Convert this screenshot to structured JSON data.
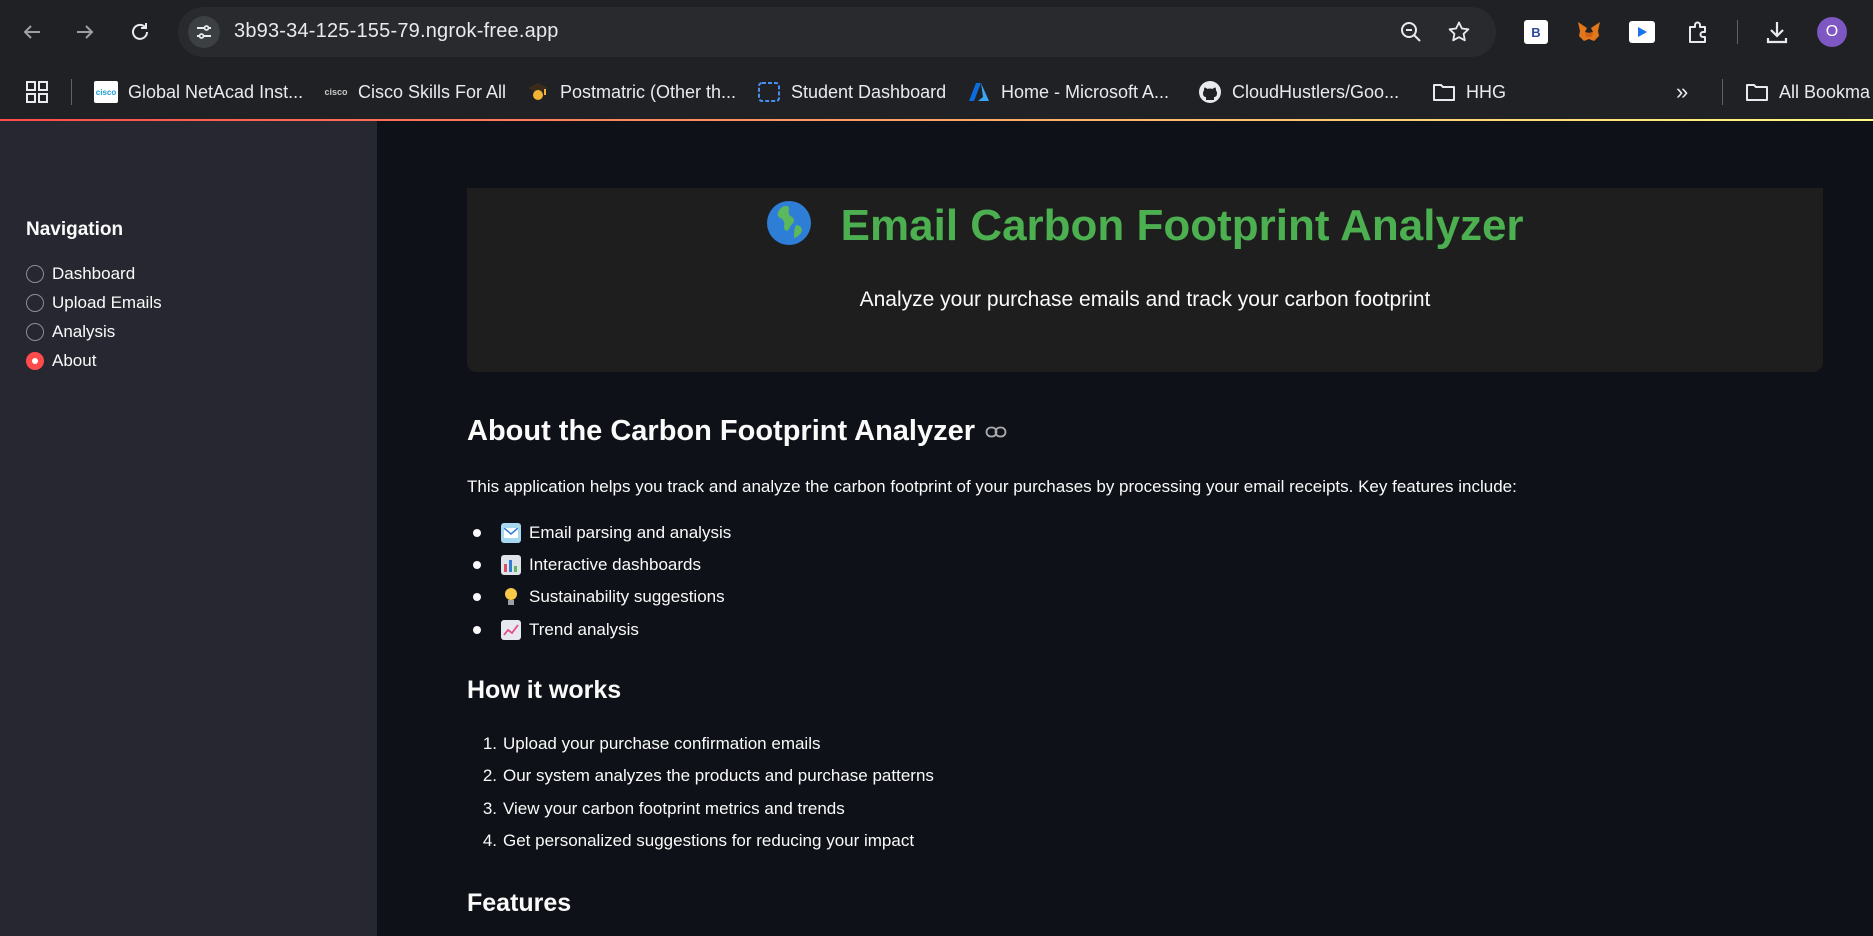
{
  "browser": {
    "url": "3b93-34-125-155-79.ngrok-free.app",
    "profile_initial": "O",
    "bookmarks": [
      {
        "label": "Global NetAcad Inst...",
        "icon": "cisco-icon"
      },
      {
        "label": "Cisco Skills For All",
        "icon": "cisco-icon"
      },
      {
        "label": "Postmatric (Other th...",
        "icon": "graduate-icon"
      },
      {
        "label": "Student Dashboard",
        "icon": "dashboard-icon"
      },
      {
        "label": "Home - Microsoft A...",
        "icon": "azure-icon"
      },
      {
        "label": "CloudHustlers/Goo...",
        "icon": "github-icon"
      },
      {
        "label": "HHG",
        "icon": "folder-icon"
      }
    ],
    "all_bookmarks": "All Bookma"
  },
  "sidebar": {
    "title": "Navigation",
    "items": [
      {
        "label": "Dashboard",
        "selected": false
      },
      {
        "label": "Upload Emails",
        "selected": false
      },
      {
        "label": "Analysis",
        "selected": false
      },
      {
        "label": "About",
        "selected": true
      }
    ]
  },
  "header": {
    "title": "Email Carbon Footprint Analyzer",
    "subtitle": "Analyze your purchase emails and track your carbon footprint"
  },
  "about": {
    "heading": "About the Carbon Footprint Analyzer",
    "intro": "This application helps you track and analyze the carbon footprint of your purchases by processing your email receipts. Key features include:",
    "features": [
      {
        "label": "Email parsing and analysis",
        "icon": "email-icon"
      },
      {
        "label": "Interactive dashboards",
        "icon": "bar-chart-icon"
      },
      {
        "label": "Sustainability suggestions",
        "icon": "lightbulb-icon"
      },
      {
        "label": "Trend analysis",
        "icon": "trend-icon"
      }
    ]
  },
  "how": {
    "heading": "How it works",
    "steps": [
      "Upload your purchase confirmation emails",
      "Our system analyzes the products and purchase patterns",
      "View your carbon footprint metrics and trends",
      "Get personalized suggestions for reducing your impact"
    ]
  },
  "features_heading": "Features",
  "colors": {
    "accent": "#ff4b4b",
    "title_green": "#4caf50",
    "sidebar_bg": "#262730",
    "main_bg": "#0e1117"
  }
}
